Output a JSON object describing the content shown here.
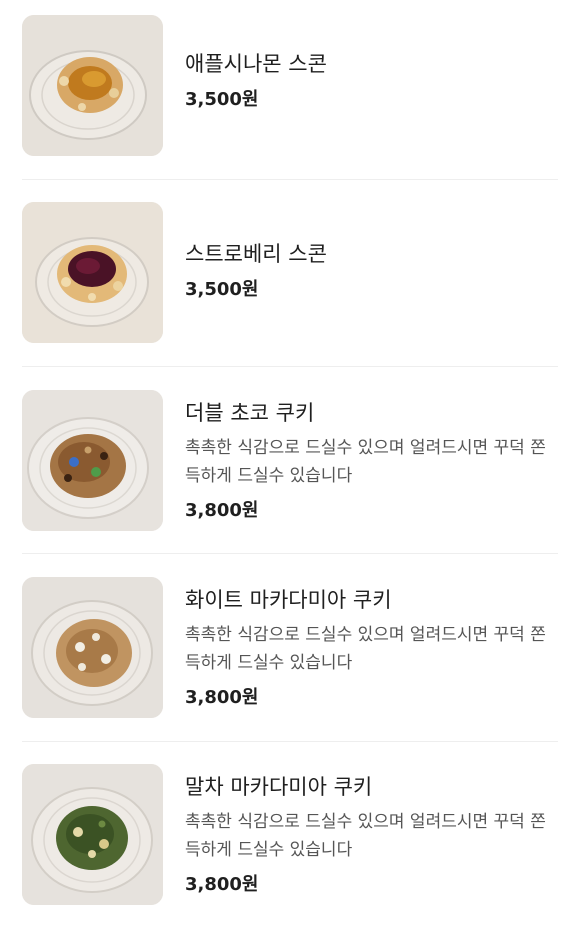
{
  "menu": {
    "items": [
      {
        "name": "애플시나몬 스콘",
        "description": "",
        "price": "3,500원",
        "thumbnail_icon": "apple-cinnamon-scone-photo"
      },
      {
        "name": "스트로베리 스콘",
        "description": "",
        "price": "3,500원",
        "thumbnail_icon": "strawberry-scone-photo"
      },
      {
        "name": "더블 초코 쿠키",
        "description": "촉촉한 식감으로 드실수 있으며 얼려드시면 꾸덕 쫀득하게 드실수 있습니다",
        "price": "3,800원",
        "thumbnail_icon": "double-choco-cookie-photo"
      },
      {
        "name": "화이트 마카다미아 쿠키",
        "description": "촉촉한 식감으로 드실수 있으며 얼려드시면 꾸덕 쫀득하게 드실수 있습니다",
        "price": "3,800원",
        "thumbnail_icon": "white-macadamia-cookie-photo"
      },
      {
        "name": "말차 마카다미아 쿠키",
        "description": "촉촉한 식감으로 드실수 있으며 얼려드시면 꾸덕 쫀득하게 드실수 있습니다",
        "price": "3,800원",
        "thumbnail_icon": "matcha-macadamia-cookie-photo"
      }
    ]
  }
}
